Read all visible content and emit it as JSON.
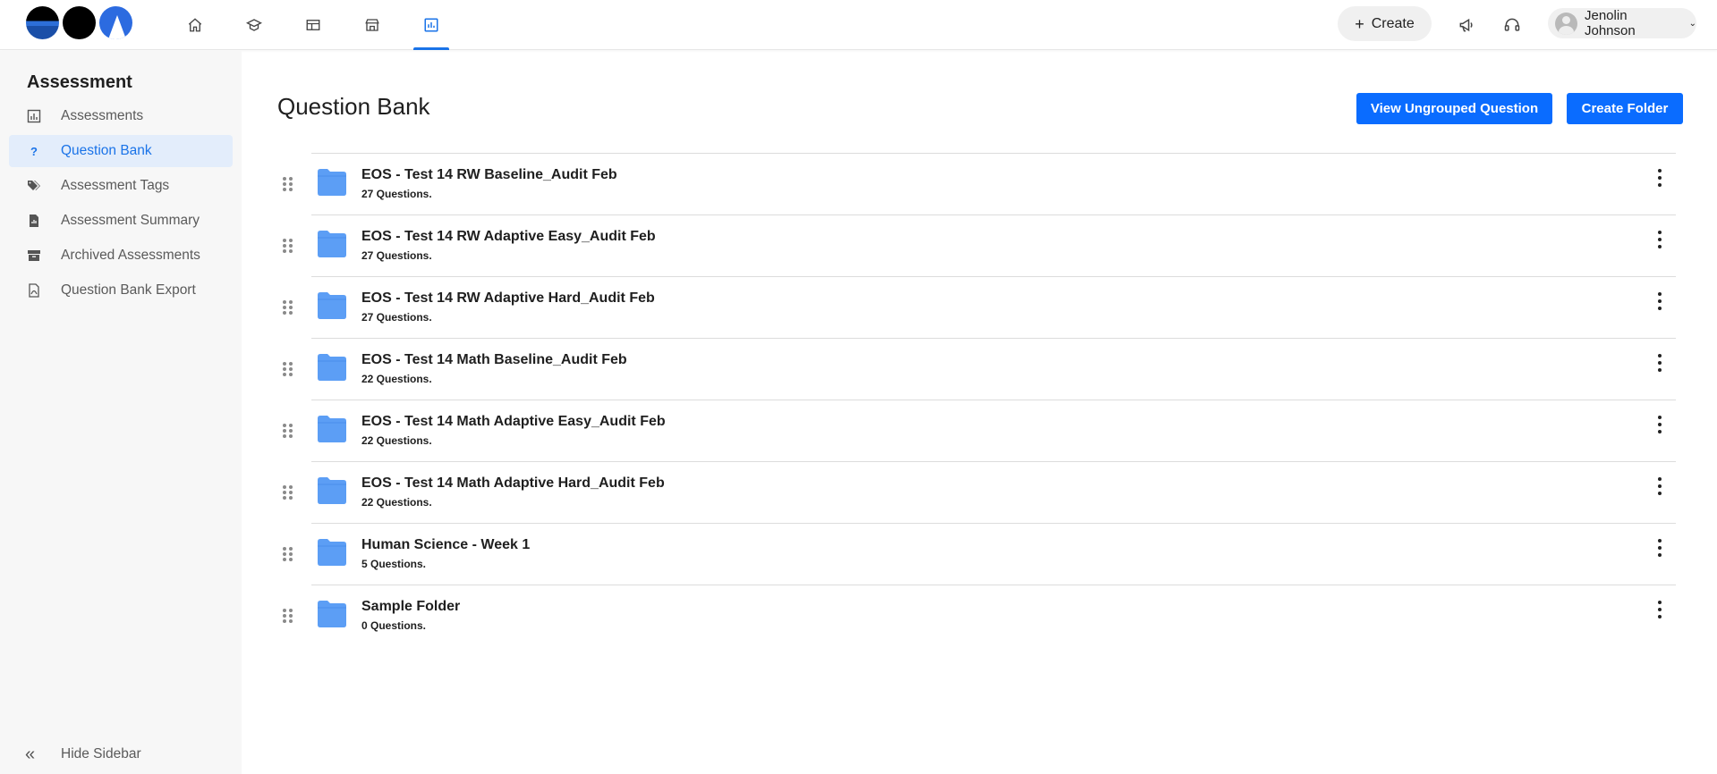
{
  "header": {
    "nav_icons": [
      {
        "name": "home-icon",
        "active": false
      },
      {
        "name": "graduation-cap-icon",
        "active": false
      },
      {
        "name": "layout-icon",
        "active": false
      },
      {
        "name": "store-icon",
        "active": false
      },
      {
        "name": "assessment-chart-icon",
        "active": true
      }
    ],
    "create_label": "Create",
    "user_name": "Jenolin Johnson",
    "accent": "#1a73e8"
  },
  "sidebar": {
    "title": "Assessment",
    "items": [
      {
        "label": "Assessments",
        "icon": "bar-chart-icon",
        "active": false
      },
      {
        "label": "Question Bank",
        "icon": "question-mark-icon",
        "active": true
      },
      {
        "label": "Assessment Tags",
        "icon": "tags-icon",
        "active": false
      },
      {
        "label": "Assessment Summary",
        "icon": "summary-document-icon",
        "active": false
      },
      {
        "label": "Archived Assessments",
        "icon": "archive-box-icon",
        "active": false
      },
      {
        "label": "Question Bank Export",
        "icon": "pdf-file-icon",
        "active": false
      }
    ],
    "hide_label": "Hide Sidebar"
  },
  "main": {
    "title": "Question Bank",
    "view_ungrouped_label": "View Ungrouped Question",
    "create_folder_label": "Create Folder",
    "folders": [
      {
        "name": "EOS - Test 14 RW Baseline_Audit Feb",
        "count": "27 Questions."
      },
      {
        "name": "EOS - Test 14 RW Adaptive Easy_Audit Feb",
        "count": "27 Questions."
      },
      {
        "name": "EOS - Test 14 RW Adaptive Hard_Audit Feb",
        "count": "27 Questions."
      },
      {
        "name": "EOS - Test 14 Math Baseline_Audit Feb",
        "count": "22 Questions."
      },
      {
        "name": "EOS - Test 14 Math Adaptive Easy_Audit Feb",
        "count": "22 Questions."
      },
      {
        "name": "EOS - Test 14 Math Adaptive Hard_Audit Feb",
        "count": "22 Questions."
      },
      {
        "name": "Human Science - Week 1",
        "count": "5 Questions."
      },
      {
        "name": "Sample Folder",
        "count": "0 Questions."
      }
    ]
  }
}
